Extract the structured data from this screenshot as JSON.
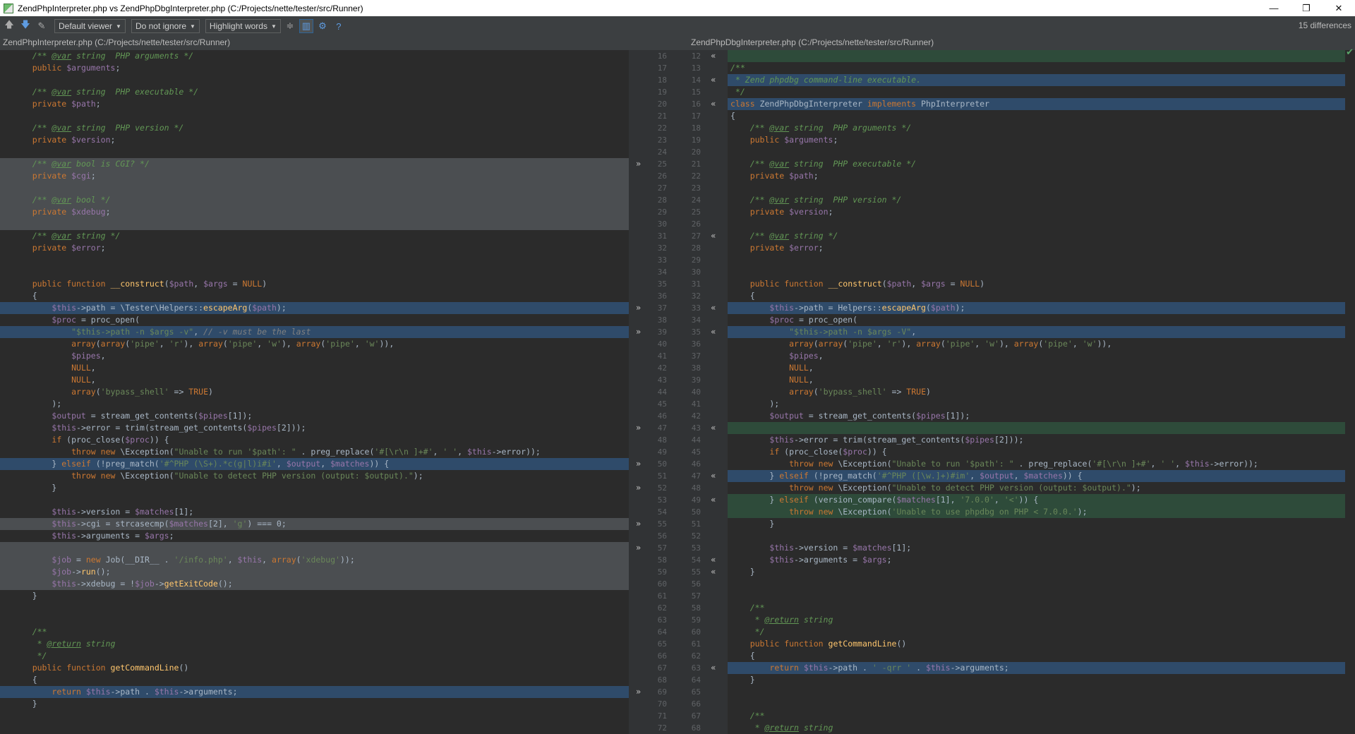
{
  "window": {
    "title": "ZendPhpInterpreter.php vs ZendPhpDbgInterpreter.php (C:/Projects/nette/tester/src/Runner)",
    "minimize": "—",
    "maximize": "❐",
    "close": "✕"
  },
  "toolbar": {
    "viewer": "Default viewer",
    "ignore": "Do not ignore",
    "highlight": "Highlight words",
    "differences": "15 differences"
  },
  "left": {
    "header": "ZendPhpInterpreter.php (C:/Projects/nette/tester/src/Runner)",
    "lines": [
      {
        "n": 16,
        "code": "\t/** @var string  PHP arguments */",
        "hl": ""
      },
      {
        "n": 17,
        "code": "\tpublic $arguments;",
        "hl": ""
      },
      {
        "n": 18,
        "code": "",
        "hl": ""
      },
      {
        "n": 19,
        "code": "\t/** @var string  PHP executable */",
        "hl": ""
      },
      {
        "n": 20,
        "code": "\tprivate $path;",
        "hl": ""
      },
      {
        "n": 21,
        "code": "",
        "hl": ""
      },
      {
        "n": 22,
        "code": "\t/** @var string  PHP version */",
        "hl": ""
      },
      {
        "n": 23,
        "code": "\tprivate $version;",
        "hl": ""
      },
      {
        "n": 24,
        "code": "",
        "hl": ""
      },
      {
        "n": 25,
        "code": "\t/** @var bool is CGI? */",
        "hl": "del"
      },
      {
        "n": 26,
        "code": "\tprivate $cgi;",
        "hl": "del"
      },
      {
        "n": 27,
        "code": "",
        "hl": "del"
      },
      {
        "n": 28,
        "code": "\t/** @var bool */",
        "hl": "del"
      },
      {
        "n": 29,
        "code": "\tprivate $xdebug;",
        "hl": "del"
      },
      {
        "n": 30,
        "code": "",
        "hl": "del"
      },
      {
        "n": 31,
        "code": "\t/** @var string */",
        "hl": ""
      },
      {
        "n": 32,
        "code": "\tprivate $error;",
        "hl": ""
      },
      {
        "n": 33,
        "code": "",
        "hl": ""
      },
      {
        "n": 34,
        "code": "",
        "hl": ""
      },
      {
        "n": 35,
        "code": "\tpublic function __construct($path, $args = NULL)",
        "hl": ""
      },
      {
        "n": 36,
        "code": "\t{",
        "hl": ""
      },
      {
        "n": 37,
        "code": "\t\t$this->path = \\Tester\\Helpers::escapeArg($path);",
        "hl": "mod"
      },
      {
        "n": 38,
        "code": "\t\t$proc = proc_open(",
        "hl": ""
      },
      {
        "n": 39,
        "code": "\t\t\t\"$this->path -n $args -v\", // -v must be the last",
        "hl": "mod"
      },
      {
        "n": 40,
        "code": "\t\t\tarray(array('pipe', 'r'), array('pipe', 'w'), array('pipe', 'w')),",
        "hl": ""
      },
      {
        "n": 41,
        "code": "\t\t\t$pipes,",
        "hl": ""
      },
      {
        "n": 42,
        "code": "\t\t\tNULL,",
        "hl": ""
      },
      {
        "n": 43,
        "code": "\t\t\tNULL,",
        "hl": ""
      },
      {
        "n": 44,
        "code": "\t\t\tarray('bypass_shell' => TRUE)",
        "hl": ""
      },
      {
        "n": 45,
        "code": "\t\t);",
        "hl": ""
      },
      {
        "n": 46,
        "code": "\t\t$output = stream_get_contents($pipes[1]);",
        "hl": ""
      },
      {
        "n": 47,
        "code": "\t\t$this->error = trim(stream_get_contents($pipes[2]));",
        "hl": ""
      },
      {
        "n": 48,
        "code": "\t\tif (proc_close($proc)) {",
        "hl": ""
      },
      {
        "n": 49,
        "code": "\t\t\tthrow new \\Exception(\"Unable to run '$path': \" . preg_replace('#[\\r\\n ]+#', ' ', $this->error));",
        "hl": ""
      },
      {
        "n": 50,
        "code": "\t\t} elseif (!preg_match('#^PHP (\\S+).*c(g|l)i#i', $output, $matches)) {",
        "hl": "mod"
      },
      {
        "n": 51,
        "code": "\t\t\tthrow new \\Exception(\"Unable to detect PHP version (output: $output).\");",
        "hl": ""
      },
      {
        "n": 52,
        "code": "\t\t}",
        "hl": ""
      },
      {
        "n": 53,
        "code": "",
        "hl": ""
      },
      {
        "n": 54,
        "code": "\t\t$this->version = $matches[1];",
        "hl": ""
      },
      {
        "n": 55,
        "code": "\t\t$this->cgi = strcasecmp($matches[2], 'g') === 0;",
        "hl": "del"
      },
      {
        "n": 56,
        "code": "\t\t$this->arguments = $args;",
        "hl": ""
      },
      {
        "n": 57,
        "code": "",
        "hl": "del"
      },
      {
        "n": 58,
        "code": "\t\t$job = new Job(__DIR__ . '/info.php', $this, array('xdebug'));",
        "hl": "del"
      },
      {
        "n": 59,
        "code": "\t\t$job->run();",
        "hl": "del"
      },
      {
        "n": 60,
        "code": "\t\t$this->xdebug = !$job->getExitCode();",
        "hl": "del"
      },
      {
        "n": 61,
        "code": "\t}",
        "hl": ""
      },
      {
        "n": 62,
        "code": "",
        "hl": ""
      },
      {
        "n": 63,
        "code": "",
        "hl": ""
      },
      {
        "n": 64,
        "code": "\t/**",
        "hl": ""
      },
      {
        "n": 65,
        "code": "\t * @return string",
        "hl": ""
      },
      {
        "n": 66,
        "code": "\t */",
        "hl": ""
      },
      {
        "n": 67,
        "code": "\tpublic function getCommandLine()",
        "hl": ""
      },
      {
        "n": 68,
        "code": "\t{",
        "hl": ""
      },
      {
        "n": 69,
        "code": "\t\treturn $this->path . $this->arguments;",
        "hl": "mod"
      },
      {
        "n": 70,
        "code": "\t}",
        "hl": ""
      },
      {
        "n": 71,
        "code": "",
        "hl": ""
      },
      {
        "n": 72,
        "code": "",
        "hl": ""
      }
    ]
  },
  "right": {
    "header": "ZendPhpDbgInterpreter.php (C:/Projects/nette/tester/src/Runner)",
    "lines": [
      {
        "n": 12,
        "code": "",
        "hl": "ins"
      },
      {
        "n": 13,
        "code": "/**",
        "hl": ""
      },
      {
        "n": 14,
        "code": " * Zend phpdbg command-line executable.",
        "hl": "mod"
      },
      {
        "n": 15,
        "code": " */",
        "hl": ""
      },
      {
        "n": 16,
        "code": "class ZendPhpDbgInterpreter implements PhpInterpreter",
        "hl": "mod"
      },
      {
        "n": 17,
        "code": "{",
        "hl": ""
      },
      {
        "n": 18,
        "code": "\t/** @var string  PHP arguments */",
        "hl": ""
      },
      {
        "n": 19,
        "code": "\tpublic $arguments;",
        "hl": ""
      },
      {
        "n": 20,
        "code": "",
        "hl": ""
      },
      {
        "n": 21,
        "code": "\t/** @var string  PHP executable */",
        "hl": ""
      },
      {
        "n": 22,
        "code": "\tprivate $path;",
        "hl": ""
      },
      {
        "n": 23,
        "code": "",
        "hl": ""
      },
      {
        "n": 24,
        "code": "\t/** @var string  PHP version */",
        "hl": ""
      },
      {
        "n": 25,
        "code": "\tprivate $version;",
        "hl": ""
      },
      {
        "n": 26,
        "code": "",
        "hl": ""
      },
      {
        "n": 27,
        "code": "\t/** @var string */",
        "hl": ""
      },
      {
        "n": 28,
        "code": "\tprivate $error;",
        "hl": ""
      },
      {
        "n": 29,
        "code": "",
        "hl": ""
      },
      {
        "n": 30,
        "code": "",
        "hl": ""
      },
      {
        "n": 31,
        "code": "\tpublic function __construct($path, $args = NULL)",
        "hl": ""
      },
      {
        "n": 32,
        "code": "\t{",
        "hl": ""
      },
      {
        "n": 33,
        "code": "\t\t$this->path = Helpers::escapeArg($path);",
        "hl": "mod"
      },
      {
        "n": 34,
        "code": "\t\t$proc = proc_open(",
        "hl": ""
      },
      {
        "n": 35,
        "code": "\t\t\t\"$this->path -n $args -V\",",
        "hl": "mod"
      },
      {
        "n": 36,
        "code": "\t\t\tarray(array('pipe', 'r'), array('pipe', 'w'), array('pipe', 'w')),",
        "hl": ""
      },
      {
        "n": 37,
        "code": "\t\t\t$pipes,",
        "hl": ""
      },
      {
        "n": 38,
        "code": "\t\t\tNULL,",
        "hl": ""
      },
      {
        "n": 39,
        "code": "\t\t\tNULL,",
        "hl": ""
      },
      {
        "n": 40,
        "code": "\t\t\tarray('bypass_shell' => TRUE)",
        "hl": ""
      },
      {
        "n": 41,
        "code": "\t\t);",
        "hl": ""
      },
      {
        "n": 42,
        "code": "\t\t$output = stream_get_contents($pipes[1]);",
        "hl": ""
      },
      {
        "n": 43,
        "code": "",
        "hl": "ins"
      },
      {
        "n": 44,
        "code": "\t\t$this->error = trim(stream_get_contents($pipes[2]));",
        "hl": ""
      },
      {
        "n": 45,
        "code": "\t\tif (proc_close($proc)) {",
        "hl": ""
      },
      {
        "n": 46,
        "code": "\t\t\tthrow new \\Exception(\"Unable to run '$path': \" . preg_replace('#[\\r\\n ]+#', ' ', $this->error));",
        "hl": ""
      },
      {
        "n": 47,
        "code": "\t\t} elseif (!preg_match('#^PHP ([\\w.]+)#im', $output, $matches)) {",
        "hl": "mod"
      },
      {
        "n": 48,
        "code": "\t\t\tthrow new \\Exception(\"Unable to detect PHP version (output: $output).\");",
        "hl": ""
      },
      {
        "n": 49,
        "code": "\t\t} elseif (version_compare($matches[1], '7.0.0', '<')) {",
        "hl": "ins"
      },
      {
        "n": 50,
        "code": "\t\t\tthrow new \\Exception('Unable to use phpdbg on PHP < 7.0.0.');",
        "hl": "ins"
      },
      {
        "n": 51,
        "code": "\t\t}",
        "hl": ""
      },
      {
        "n": 52,
        "code": "",
        "hl": ""
      },
      {
        "n": 53,
        "code": "\t\t$this->version = $matches[1];",
        "hl": ""
      },
      {
        "n": 54,
        "code": "\t\t$this->arguments = $args;",
        "hl": ""
      },
      {
        "n": 55,
        "code": "\t}",
        "hl": ""
      },
      {
        "n": 56,
        "code": "",
        "hl": ""
      },
      {
        "n": 57,
        "code": "",
        "hl": ""
      },
      {
        "n": 58,
        "code": "\t/**",
        "hl": ""
      },
      {
        "n": 59,
        "code": "\t * @return string",
        "hl": ""
      },
      {
        "n": 60,
        "code": "\t */",
        "hl": ""
      },
      {
        "n": 61,
        "code": "\tpublic function getCommandLine()",
        "hl": ""
      },
      {
        "n": 62,
        "code": "\t{",
        "hl": ""
      },
      {
        "n": 63,
        "code": "\t\treturn $this->path . ' -qrr ' . $this->arguments;",
        "hl": "mod"
      },
      {
        "n": 64,
        "code": "\t}",
        "hl": ""
      },
      {
        "n": 65,
        "code": "",
        "hl": ""
      },
      {
        "n": 66,
        "code": "",
        "hl": ""
      },
      {
        "n": 67,
        "code": "\t/**",
        "hl": ""
      },
      {
        "n": 68,
        "code": "\t * @return string",
        "hl": ""
      }
    ]
  },
  "gutter_marks": {
    "left_arrows": [
      25,
      37,
      39,
      47,
      50,
      52,
      55,
      57,
      69
    ],
    "right_arrows": [
      12,
      14,
      16,
      27,
      33,
      35,
      43,
      47,
      49,
      54,
      55,
      63
    ]
  },
  "icons": {
    "prev": "up-arrow-icon",
    "next": "down-arrow-icon",
    "edit": "edit-source-icon",
    "collapse": "collapse-unchanged-icon",
    "sync": "sync-scroll-icon",
    "settings": "gear-icon",
    "help": "help-icon"
  }
}
